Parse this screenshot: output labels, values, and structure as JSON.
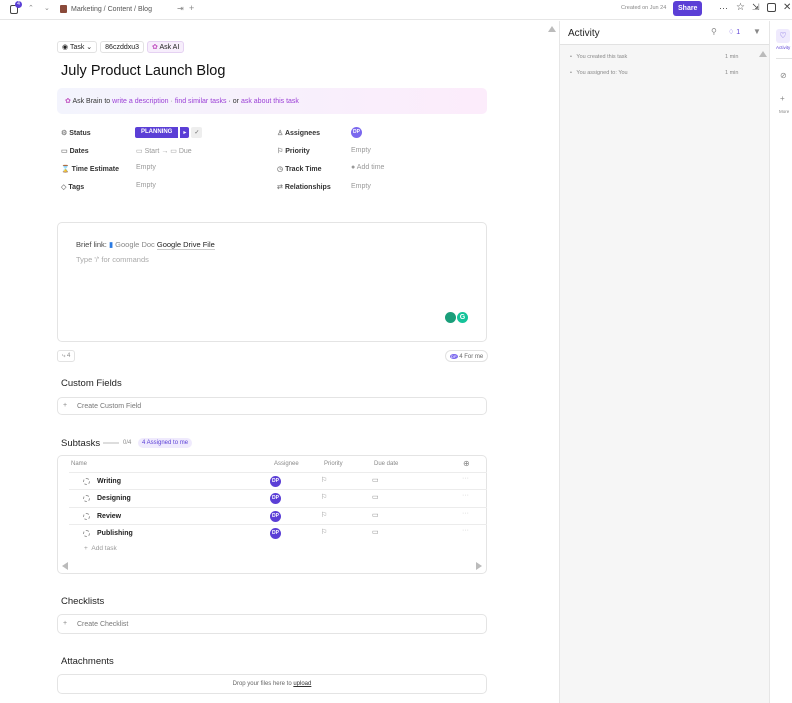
{
  "topbar": {
    "notif_count": "4",
    "breadcrumb": [
      "Marketing",
      "Content",
      "Blog"
    ],
    "created": "Created on Jun 24",
    "share": "Share"
  },
  "task": {
    "type": "Task",
    "id": "86czddxu3",
    "ask_ai": "Ask AI",
    "title": "July Product Launch Blog"
  },
  "brain": {
    "prefix": "Ask Brain to",
    "link1": "write a description",
    "sep1": "·",
    "link2": "find similar tasks",
    "sep2": "· or",
    "link3": "ask about this task"
  },
  "props": {
    "status_label": "Status",
    "status_value": "PLANNING",
    "dates_label": "Dates",
    "start": "Start",
    "arrow": "→",
    "due": "Due",
    "time_estimate_label": "Time Estimate",
    "time_estimate_value": "Empty",
    "tags_label": "Tags",
    "tags_value": "Empty",
    "assignees_label": "Assignees",
    "assignee_initials": "DP",
    "priority_label": "Priority",
    "priority_value": "Empty",
    "track_label": "Track Time",
    "track_value": "Add time",
    "relationships_label": "Relationships",
    "relationships_value": "Empty"
  },
  "editor": {
    "brief_label": "Brief link:",
    "doc_type": "Google Doc",
    "doc_name": "Google Drive File",
    "placeholder": "Type '/' for commands"
  },
  "footer_pills": {
    "subtask_count": "4",
    "for_me": "4 For me",
    "for_me_initials": "DP"
  },
  "custom_fields": {
    "title": "Custom Fields",
    "create": "Create Custom Field"
  },
  "subtasks": {
    "title": "Subtasks",
    "progress": "0/4",
    "assigned": "4 Assigned to me",
    "progress_fraction": 0,
    "columns": [
      "Name",
      "Assignee",
      "Priority",
      "Due date"
    ],
    "rows": [
      {
        "name": "Writing",
        "assignee": "DP"
      },
      {
        "name": "Designing",
        "assignee": "DP"
      },
      {
        "name": "Review",
        "assignee": "DP"
      },
      {
        "name": "Publishing",
        "assignee": "DP"
      }
    ],
    "add": "Add task"
  },
  "checklists": {
    "title": "Checklists",
    "create": "Create Checklist"
  },
  "attachments": {
    "title": "Attachments",
    "drop": "Drop your files here to",
    "upload": "upload"
  },
  "activity": {
    "title": "Activity",
    "comment_count": "1",
    "items": [
      {
        "text": "You created this task",
        "time": "1 min"
      },
      {
        "text": "You assigned to: You",
        "time": "1 min"
      }
    ]
  },
  "rail": {
    "activity": "Activity",
    "more": "More"
  },
  "colors": {
    "accent": "#5b3fd6",
    "brain_link": "#9b3fd6"
  }
}
